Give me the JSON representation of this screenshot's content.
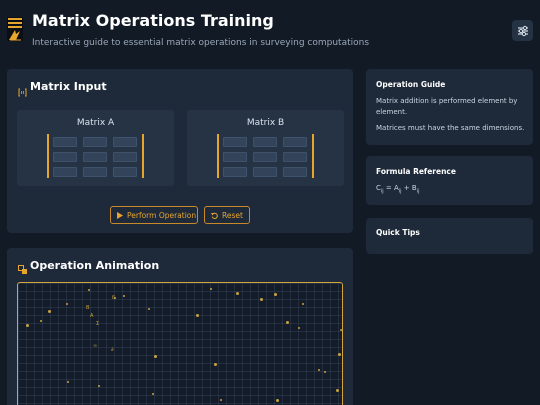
{
  "header": {
    "title": "Matrix Operations Training",
    "subtitle": "Interactive guide to essential matrix operations in surveying computations",
    "settings_icon": "sliders-icon"
  },
  "matrix_input": {
    "title": "Matrix Input",
    "icon": "matrix-brackets-icon",
    "matrix_a_label": "Matrix A",
    "matrix_b_label": "Matrix B",
    "rows": 3,
    "cols": 3
  },
  "actions": {
    "perform_label": "Perform Operation",
    "reset_label": "Reset"
  },
  "animation": {
    "title": "Operation Animation",
    "icon": "shapes-icon"
  },
  "guide": {
    "title": "Operation Guide",
    "text1": "Matrix addition is performed element by element.",
    "text2": "Matrices must have the same dimensions."
  },
  "formula": {
    "title": "Formula Reference",
    "lhs": "C",
    "lhs_sub": "ij",
    "eq": " = A",
    "a_sub": "ij",
    "plus": " + B",
    "b_sub": "ij"
  },
  "tips": {
    "title": "Quick Tips"
  },
  "colors": {
    "background": "#121a26",
    "panel": "#1e2a3a",
    "accent": "#e8a52e"
  }
}
